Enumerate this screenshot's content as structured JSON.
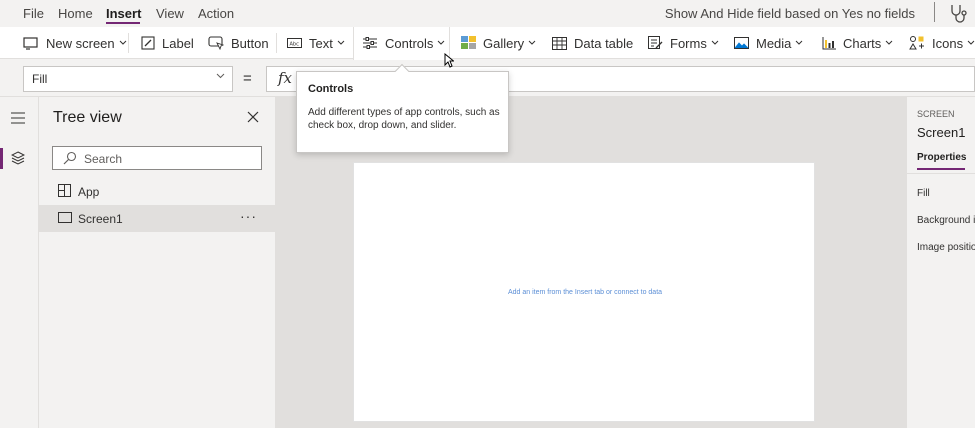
{
  "menu": {
    "items": [
      {
        "label": "File",
        "active": false
      },
      {
        "label": "Home",
        "active": false
      },
      {
        "label": "Insert",
        "active": true
      },
      {
        "label": "View",
        "active": false
      },
      {
        "label": "Action",
        "active": false
      }
    ],
    "app_title": "Show And Hide field based on Yes no fields"
  },
  "ribbon": {
    "new_screen": "New screen",
    "label": "Label",
    "button": "Button",
    "text": "Text",
    "controls": "Controls",
    "gallery": "Gallery",
    "data_table": "Data table",
    "forms": "Forms",
    "media": "Media",
    "charts": "Charts",
    "icons": "Icons"
  },
  "formula": {
    "property": "Fill",
    "equals": "=",
    "fx": "fx",
    "value": ""
  },
  "tree": {
    "title": "Tree view",
    "search_placeholder": "Search",
    "nodes": [
      {
        "label": "App",
        "icon": "app-icon"
      },
      {
        "label": "Screen1",
        "icon": "screen-icon",
        "selected": true,
        "more": "···"
      }
    ]
  },
  "canvas": {
    "hint": "Add an item from the Insert tab or connect to data"
  },
  "properties": {
    "type_label": "SCREEN",
    "name": "Screen1",
    "tab": "Properties",
    "rows": [
      "Fill",
      "Background i",
      "Image positio"
    ]
  },
  "tooltip": {
    "title": "Controls",
    "body": "Add different types of app controls, such as check box, drop down, and slider."
  },
  "colors": {
    "accent": "#742774",
    "link": "#5c8fd6"
  }
}
